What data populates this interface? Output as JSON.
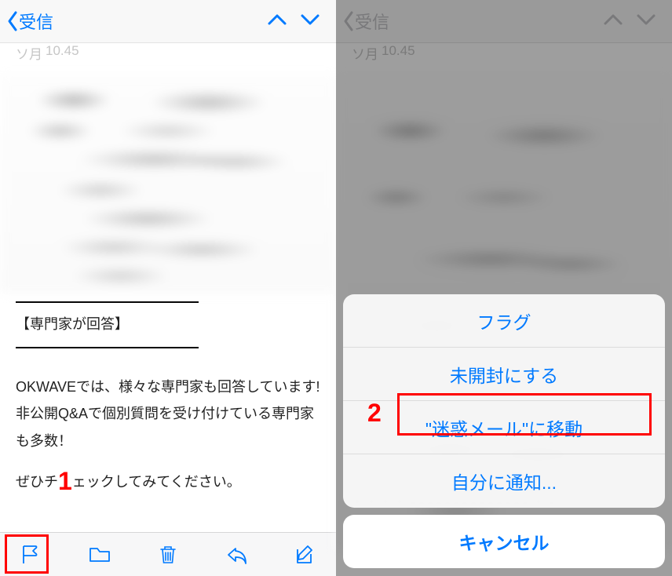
{
  "left": {
    "nav": {
      "back_label": "受信"
    },
    "timestamp": {
      "date_fragment": "ソ月",
      "time": "10.45"
    },
    "section_title": "【専門家が回答】",
    "body_line1": "OKWAVEでは、様々な専門家も回答しています!",
    "body_line2": "非公開Q&Aで個別質問を受け付けている専門家も多数！",
    "body_line3_prefix": "ぜひチ",
    "body_line3_suffix": "ェックしてみてください。",
    "annotation_number": "1"
  },
  "right": {
    "nav": {
      "back_label": "受信"
    },
    "timestamp": {
      "date_fragment": "ソ月",
      "time": "10.45"
    },
    "truncated_body": "・・・・ - - - - - - - - - - - - - - ・ -",
    "sheet": {
      "flag": "フラグ",
      "mark_unread": "未開封にする",
      "move_to_junk": "\"迷惑メール\"に移動",
      "notify_me": "自分に通知...",
      "cancel": "キャンセル"
    },
    "annotation_number": "2"
  }
}
